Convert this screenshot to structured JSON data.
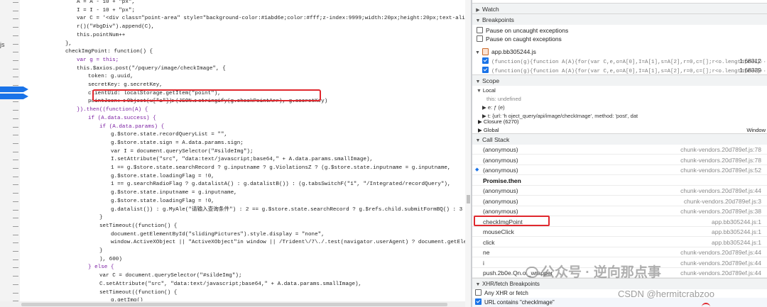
{
  "editor": {
    "gutter_label": "js",
    "code_lines": [
      {
        "text": "A = A - 10 + \"px\",",
        "indent": 1,
        "kw": false
      },
      {
        "text": "I = I - 10 + \"px\";",
        "indent": 1,
        "kw": false
      },
      {
        "text": "var C = '<div class=\"point-area\" style=\"background-color:#1abd6e;color:#fff;z-index:9999;width:20px;height:20px;text-align:center;lin",
        "indent": 1,
        "kw": false
      },
      {
        "text": "r()(\"#bgDiv\").append(C),",
        "indent": 1,
        "kw": false
      },
      {
        "text": "this.pointNum++",
        "indent": 1,
        "kw": false
      },
      {
        "text": "},",
        "indent": 0,
        "kw": false
      },
      {
        "text": "checkImgPoint: function() {",
        "indent": 0,
        "kw": false
      },
      {
        "text": "var g = this;",
        "indent": 1,
        "kw": true
      },
      {
        "text": "this.$axios.post(\"/pquery/image/checkImage\", {",
        "indent": 1,
        "kw": false
      },
      {
        "text": "token: g.uuid,",
        "indent": 2,
        "kw": false
      },
      {
        "text": "secretKey: g.secretKey,",
        "indent": 2,
        "kw": false
      },
      {
        "text": "clientUid: localStorage.getItem(\"point\"),",
        "indent": 2,
        "kw": false
      },
      {
        "text": "pointJson: ▶Object(u[\"a\"])▶(JSON.▶stringify(g.checkPointArr), g.secretKey)",
        "indent": 2,
        "kw": false
      },
      {
        "text": "}).then((function(A) {",
        "indent": 1,
        "kw": true
      },
      {
        "text": "if (A.data.success) {",
        "indent": 2,
        "kw": true
      },
      {
        "text": "if (A.data.params) {",
        "indent": 3,
        "kw": true
      },
      {
        "text": "g.$store.state.recordQueryList = \"\",",
        "indent": 4,
        "kw": false
      },
      {
        "text": "g.$store.state.sign = A.data.params.sign;",
        "indent": 4,
        "kw": false
      },
      {
        "text": "var I = document.querySelector(\"#sildeImg\");",
        "indent": 4,
        "kw": false
      },
      {
        "text": "I.setAttribute(\"src\", \"data:text/javascript;base64,\" + A.data.params.smallImage),",
        "indent": 4,
        "kw": false
      },
      {
        "text": "1 == g.$store.state.searchRecord ? g.inputname ? g.ViolationsZ ? (g.$store.state.inputname = g.inputname,",
        "indent": 4,
        "kw": false
      },
      {
        "text": "g.$store.state.loadingFlag = !0,",
        "indent": 4,
        "kw": false
      },
      {
        "text": "1 == g.searchRadioFlag ? g.datalistA() : g.datalistB()) : (g.tabsSwitchF(\"1\", \"/Integrated/recordQuery\"),",
        "indent": 4,
        "kw": false
      },
      {
        "text": "g.$store.state.inputname = g.inputname,",
        "indent": 4,
        "kw": false
      },
      {
        "text": "g.$store.state.loadingFlag = !0,",
        "indent": 4,
        "kw": false
      },
      {
        "text": "g.datalist()) : g.MyAle(\"请输入查询条件\") : 2 == g.$store.state.searchRecord ? g.$refs.child.submitFormBQ() : 3 == g.$sto",
        "indent": 4,
        "kw": false
      },
      {
        "text": "}",
        "indent": 3,
        "kw": false
      },
      {
        "text": "setTimeout((function() {",
        "indent": 3,
        "kw": false
      },
      {
        "text": "document.getElementById(\"slidingPictures\").style.display = \"none\",",
        "indent": 4,
        "kw": false
      },
      {
        "text": "window.ActiveXObject || \"ActiveXObject\"in window || /Trident\\/7\\./.test(navigator.userAgent) ? document.getElementById(\"sl",
        "indent": 4,
        "kw": false
      },
      {
        "text": "}",
        "indent": 3,
        "kw": false
      },
      {
        "text": "), 600)",
        "indent": 3,
        "kw": false
      },
      {
        "text": "} else {",
        "indent": 2,
        "kw": true
      },
      {
        "text": "var C = document.querySelector(\"#sildeImg\");",
        "indent": 3,
        "kw": false
      },
      {
        "text": "C.setAttribute(\"src\", \"data:text/javascript;base64,\" + A.data.params.smallImage),",
        "indent": 3,
        "kw": false
      },
      {
        "text": "setTimeout((function() {",
        "indent": 3,
        "kw": false
      },
      {
        "text": "g.getImg()",
        "indent": 4,
        "kw": false
      },
      {
        "text": "}",
        "indent": 3,
        "kw": false
      }
    ]
  },
  "debugger": {
    "watch_label": "Watch",
    "breakpoints_label": "Breakpoints",
    "pause_uncaught": "Pause on uncaught exceptions",
    "pause_caught": "Pause on caught exceptions",
    "bp_file": "app.bb305244.js",
    "bp_entries": [
      {
        "code": "(function(g){function A(A){for(var C,e,o=A[0],I=A[1],s=A[2],r=0,c=[];r<o.length;r++)···",
        "loc": "1:68312"
      },
      {
        "code": "(function(g){function A(A){for(var C,e,o=A[0],I=A[1],s=A[2],r=0,c=[];r<o.length;r++)···",
        "loc": "1:68339"
      }
    ],
    "scope_label": "Scope",
    "local_label": "Local",
    "scope_lines": [
      {
        "text": "this: undefined",
        "indent": 20
      },
      {
        "text": "▶ e: ƒ (e)",
        "indent": 14
      },
      {
        "text": "▶ t: {url: 'h                         oject_query/api/image/checkImage', method: 'post', dat",
        "indent": 14
      }
    ],
    "closure_label": "▶ Closure (6270)",
    "global_label": "▶ Global",
    "global_value": "Window",
    "callstack_label": "Call Stack",
    "frames": [
      {
        "name": "(anonymous)",
        "loc": "chunk-vendors.20d789ef.js:78",
        "bold": false,
        "arrow": false
      },
      {
        "name": "(anonymous)",
        "loc": "chunk-vendors.20d789ef.js:78",
        "bold": false,
        "arrow": false
      },
      {
        "name": "(anonymous)",
        "loc": "chunk-vendors.20d789ef.js:52",
        "bold": false,
        "arrow": true
      },
      {
        "name": "Promise.then",
        "loc": "",
        "bold": true,
        "arrow": false
      },
      {
        "name": "(anonymous)",
        "loc": "chunk-vendors.20d789ef.js:44",
        "bold": false,
        "arrow": false
      },
      {
        "name": "(anonymous)",
        "loc": "chunk-vendors.20d789ef.js:3",
        "bold": false,
        "arrow": false
      },
      {
        "name": "(anonymous)",
        "loc": "chunk-vendors.20d789ef.js:38",
        "bold": false,
        "arrow": false
      },
      {
        "name": "checkImgPoint",
        "loc": "app.bb305244.js:1",
        "bold": false,
        "arrow": false
      },
      {
        "name": "mouseClick",
        "loc": "app.bb305244.js:1",
        "bold": false,
        "arrow": false
      },
      {
        "name": "click",
        "loc": "app.bb305244.js:1",
        "bold": false,
        "arrow": false
      },
      {
        "name": "ne",
        "loc": "chunk-vendors.20d789ef.js:44",
        "bold": false,
        "arrow": false
      },
      {
        "name": "i",
        "loc": "chunk-vendors.20d789ef.js:44",
        "bold": false,
        "arrow": false
      },
      {
        "name": "push.2b0e.Qn.o._wrapper",
        "loc": "chunk-vendors.20d789ef.js:44",
        "bold": false,
        "arrow": false
      }
    ],
    "xhr_label": "XHR/fetch Breakpoints",
    "any_xhr": "Any XHR or fetch",
    "url_contains": "URL contains \"checkImage\""
  },
  "watermark": {
    "wechat": "公众号 · 逆向那点事",
    "csdn": "CSDN @hermitcrabzoo"
  }
}
